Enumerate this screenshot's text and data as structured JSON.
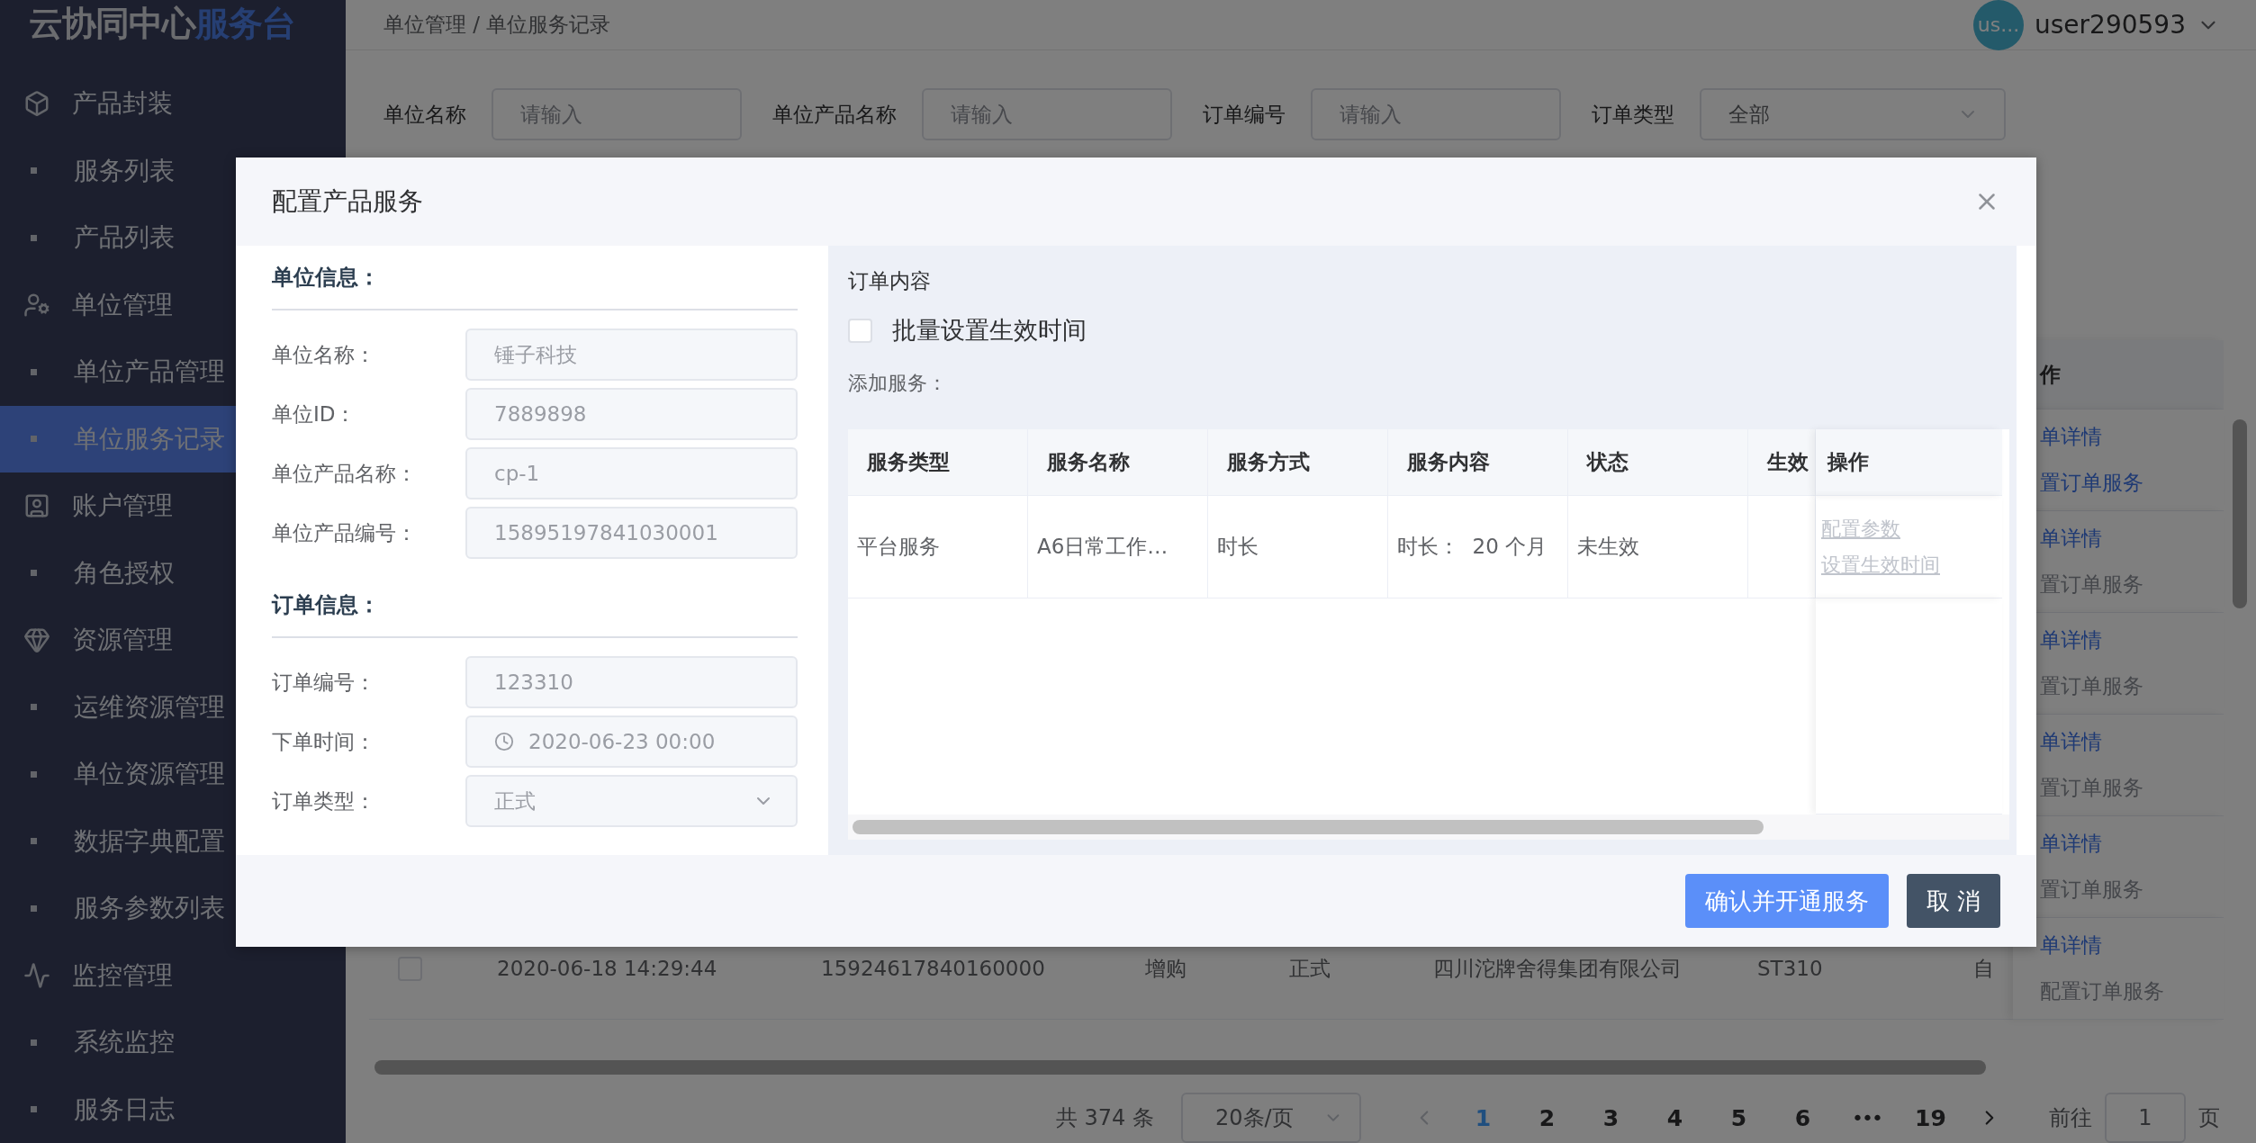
{
  "sidebar": {
    "logo": {
      "main": "云协同中心",
      "accent": "服务台"
    },
    "groups": [
      {
        "label": "产品封装",
        "children": [
          {
            "label": "服务列表",
            "selected": false
          },
          {
            "label": "产品列表",
            "selected": false
          }
        ]
      },
      {
        "label": "单位管理",
        "children": [
          {
            "label": "单位产品管理",
            "selected": false
          },
          {
            "label": "单位服务记录",
            "selected": true
          }
        ]
      },
      {
        "label": "账户管理",
        "children": [
          {
            "label": "角色授权",
            "selected": false
          }
        ]
      },
      {
        "label": "资源管理",
        "children": [
          {
            "label": "运维资源管理",
            "selected": false
          },
          {
            "label": "单位资源管理",
            "selected": false
          },
          {
            "label": "数据字典配置",
            "selected": false
          },
          {
            "label": "服务参数列表",
            "selected": false
          }
        ]
      },
      {
        "label": "监控管理",
        "children": [
          {
            "label": "系统监控",
            "selected": false
          },
          {
            "label": "服务日志",
            "selected": false
          }
        ]
      }
    ]
  },
  "header": {
    "breadcrumb": "单位管理 / 单位服务记录",
    "avatar": "us...",
    "username": "user290593"
  },
  "filters": [
    {
      "kind": "input",
      "label": "单位名称",
      "placeholder": "请输入"
    },
    {
      "kind": "input",
      "label": "单位产品名称",
      "placeholder": "请输入"
    },
    {
      "kind": "input",
      "label": "订单编号",
      "placeholder": "请输入"
    },
    {
      "kind": "select",
      "label": "订单类型",
      "value": "全部"
    }
  ],
  "orders_table": {
    "action_header": "作",
    "rows": [
      {
        "actions": [
          {
            "label": "单详情",
            "disabled": false
          },
          {
            "label": "置订单服务",
            "disabled": false
          }
        ]
      },
      {
        "actions": [
          {
            "label": "单详情",
            "disabled": false
          },
          {
            "label": "置订单服务",
            "disabled": true
          }
        ]
      },
      {
        "actions": [
          {
            "label": "单详情",
            "disabled": false
          },
          {
            "label": "置订单服务",
            "disabled": true
          }
        ]
      },
      {
        "actions": [
          {
            "label": "单详情",
            "disabled": false
          },
          {
            "label": "置订单服务",
            "disabled": true
          }
        ]
      },
      {
        "actions": [
          {
            "label": "单详情",
            "disabled": false
          },
          {
            "label": "置订单服务",
            "disabled": true
          }
        ]
      },
      {
        "checked": false,
        "cells": [
          "2020-06-18 14:29:44",
          "15924617840160000",
          "增购",
          "正式",
          "四川沱牌舍得集团有限公司",
          "ST310",
          "自"
        ],
        "actions": [
          {
            "label": "单详情",
            "disabled": false
          },
          {
            "label": "配置订单服务",
            "disabled": true
          }
        ]
      }
    ]
  },
  "pagination": {
    "total": "共 374 条",
    "page_size": "20条/页",
    "pages": [
      {
        "kind": "page",
        "label": "1",
        "selected": true
      },
      {
        "kind": "page",
        "label": "2",
        "selected": false
      },
      {
        "kind": "page",
        "label": "3",
        "selected": false
      },
      {
        "kind": "page",
        "label": "4",
        "selected": false
      },
      {
        "kind": "page",
        "label": "5",
        "selected": false
      },
      {
        "kind": "page",
        "label": "6",
        "selected": false
      },
      {
        "kind": "more",
        "label": "•••"
      },
      {
        "kind": "page",
        "label": "19",
        "selected": false
      }
    ],
    "goto_label": "前往",
    "goto_value": "1",
    "goto_suffix": "页"
  },
  "modal": {
    "title": "配置产品服务",
    "sections": [
      {
        "title": "单位信息：",
        "fields": [
          {
            "kind": "text",
            "label": "单位名称：",
            "value": "锤子科技",
            "disabled": true
          },
          {
            "kind": "text",
            "label": "单位ID：",
            "value": "7889898",
            "disabled": true
          },
          {
            "kind": "text",
            "label": "单位产品名称：",
            "value": "cp-1",
            "disabled": true
          },
          {
            "kind": "text",
            "label": "单位产品编号：",
            "value": "15895197841030001",
            "disabled": true
          }
        ]
      },
      {
        "title": "订单信息：",
        "fields": [
          {
            "kind": "text",
            "label": "订单编号：",
            "value": "123310",
            "disabled": true
          },
          {
            "kind": "date",
            "label": "下单时间：",
            "value": "2020-06-23 00:00",
            "disabled": true
          },
          {
            "kind": "select",
            "label": "订单类型：",
            "value": "正式",
            "disabled": true
          }
        ]
      }
    ],
    "content_title": "订单内容",
    "batch": {
      "label": "批量设置生效时间",
      "checked": false
    },
    "add_label": "添加服务：",
    "table": {
      "columns": [
        "服务类型",
        "服务名称",
        "服务方式",
        "服务内容",
        "状态",
        "生效"
      ],
      "action_column": "操作",
      "rows": [
        {
          "cells": [
            "平台服务",
            "A6日常工作…",
            "时长",
            "时长：  20 个月",
            "未生效"
          ],
          "actions": [
            {
              "label": "配置参数",
              "disabled": true
            },
            {
              "label": "设置生效时间",
              "disabled": true
            }
          ]
        }
      ]
    },
    "buttons": [
      {
        "kind": "primary",
        "label": "确认并开通服务"
      },
      {
        "kind": "secondary",
        "label": "取 消"
      }
    ]
  }
}
